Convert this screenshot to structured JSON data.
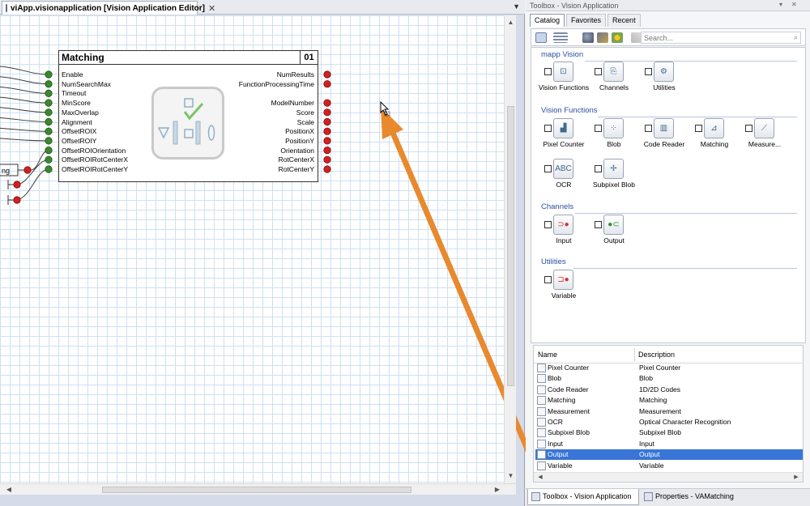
{
  "editor": {
    "tab_title": "viApp.visionapplication [Vision Application Editor]",
    "close_glyph": "✕",
    "dropdown_glyph": "▼"
  },
  "block": {
    "title": "Matching",
    "number": "01",
    "inputs": [
      "Enable",
      "NumSearchMax",
      "Timeout",
      "MinScore",
      "MaxOverlap",
      "Alignment",
      "OffsetROIX",
      "OffsetROIY",
      "OffsetROIOrientation",
      "OffsetROIRotCenterX",
      "OffsetROIRotCenterY"
    ],
    "outputs": [
      "NumResults",
      "FunctionProcessingTime",
      "",
      "ModelNumber",
      "Score",
      "Scale",
      "PositionX",
      "PositionY",
      "Orientation",
      "RotCenterX",
      "RotCenterY"
    ],
    "side_label": "ng",
    "colors": {
      "input_pin": "#3a8a2e",
      "output_pin": "#d42020",
      "wire": "#3a3a3a"
    }
  },
  "annotation": {
    "arrow_color": "#e8892e"
  },
  "toolbox": {
    "title": "Toolbox - Vision Application",
    "title_buttons": [
      "▾",
      "✕"
    ],
    "tabs": [
      "Catalog",
      "Favorites",
      "Recent"
    ],
    "search_placeholder": "Search...",
    "search_icon": "magnifier-icon",
    "sections": [
      {
        "title": "mapp Vision",
        "items": [
          "Vision Functions",
          "Channels",
          "Utilities"
        ]
      },
      {
        "title": "Vision Functions",
        "items": [
          "Pixel Counter",
          "Blob",
          "Code Reader",
          "Matching",
          "Measure...",
          "OCR",
          "Subpixel Blob"
        ]
      },
      {
        "title": "Channels",
        "items": [
          "Input",
          "Output"
        ]
      },
      {
        "title": "Utilities",
        "items": [
          "Variable"
        ]
      }
    ],
    "list": {
      "headers": [
        "Name",
        "Description"
      ],
      "rows": [
        {
          "name": "Pixel Counter",
          "desc": "Pixel Counter"
        },
        {
          "name": "Blob",
          "desc": "Blob"
        },
        {
          "name": "Code Reader",
          "desc": "1D/2D Codes"
        },
        {
          "name": "Matching",
          "desc": "Matching"
        },
        {
          "name": "Measurement",
          "desc": "Measurement"
        },
        {
          "name": "OCR",
          "desc": "Optical Character Recognition"
        },
        {
          "name": "Subpixel Blob",
          "desc": "Subpixel Blob"
        },
        {
          "name": "Input",
          "desc": "Input"
        },
        {
          "name": "Output",
          "desc": "Output"
        },
        {
          "name": "Variable",
          "desc": "Variable"
        }
      ],
      "selected_index": 8
    },
    "bottom_tabs": [
      "Toolbox - Vision Application",
      "Properties - VAMatching"
    ]
  }
}
